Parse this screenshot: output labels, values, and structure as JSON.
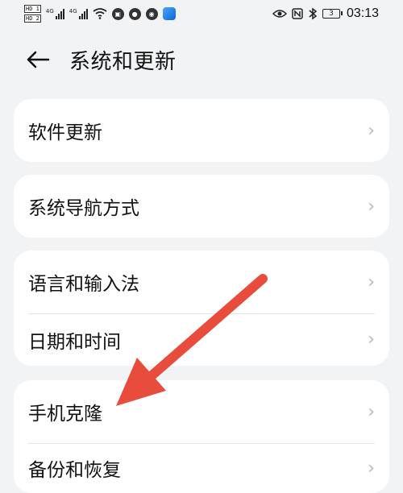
{
  "status_bar": {
    "hd1": "HD 1",
    "hd2": "HD 2",
    "net1": "4G",
    "net2": "4G",
    "battery": "3",
    "time": "03:13",
    "icons": [
      "wifi-icon",
      "vpn-icon",
      "messenger-icon",
      "weibo-icon",
      "app-icon",
      "eye-icon",
      "nfc-icon",
      "bluetooth-icon",
      "battery-icon"
    ]
  },
  "header": {
    "title": "系统和更新",
    "back_icon": "arrow-left-icon"
  },
  "settings": {
    "software_update": "软件更新",
    "system_navigation": "系统导航方式",
    "language_input": "语言和输入法",
    "date_time": "日期和时间",
    "phone_clone": "手机克隆",
    "backup_restore": "备份和恢复"
  },
  "chevron": "›",
  "colors": {
    "background": "#f1f3f5",
    "card": "#ffffff",
    "annotation_arrow": "#e74c3c"
  }
}
